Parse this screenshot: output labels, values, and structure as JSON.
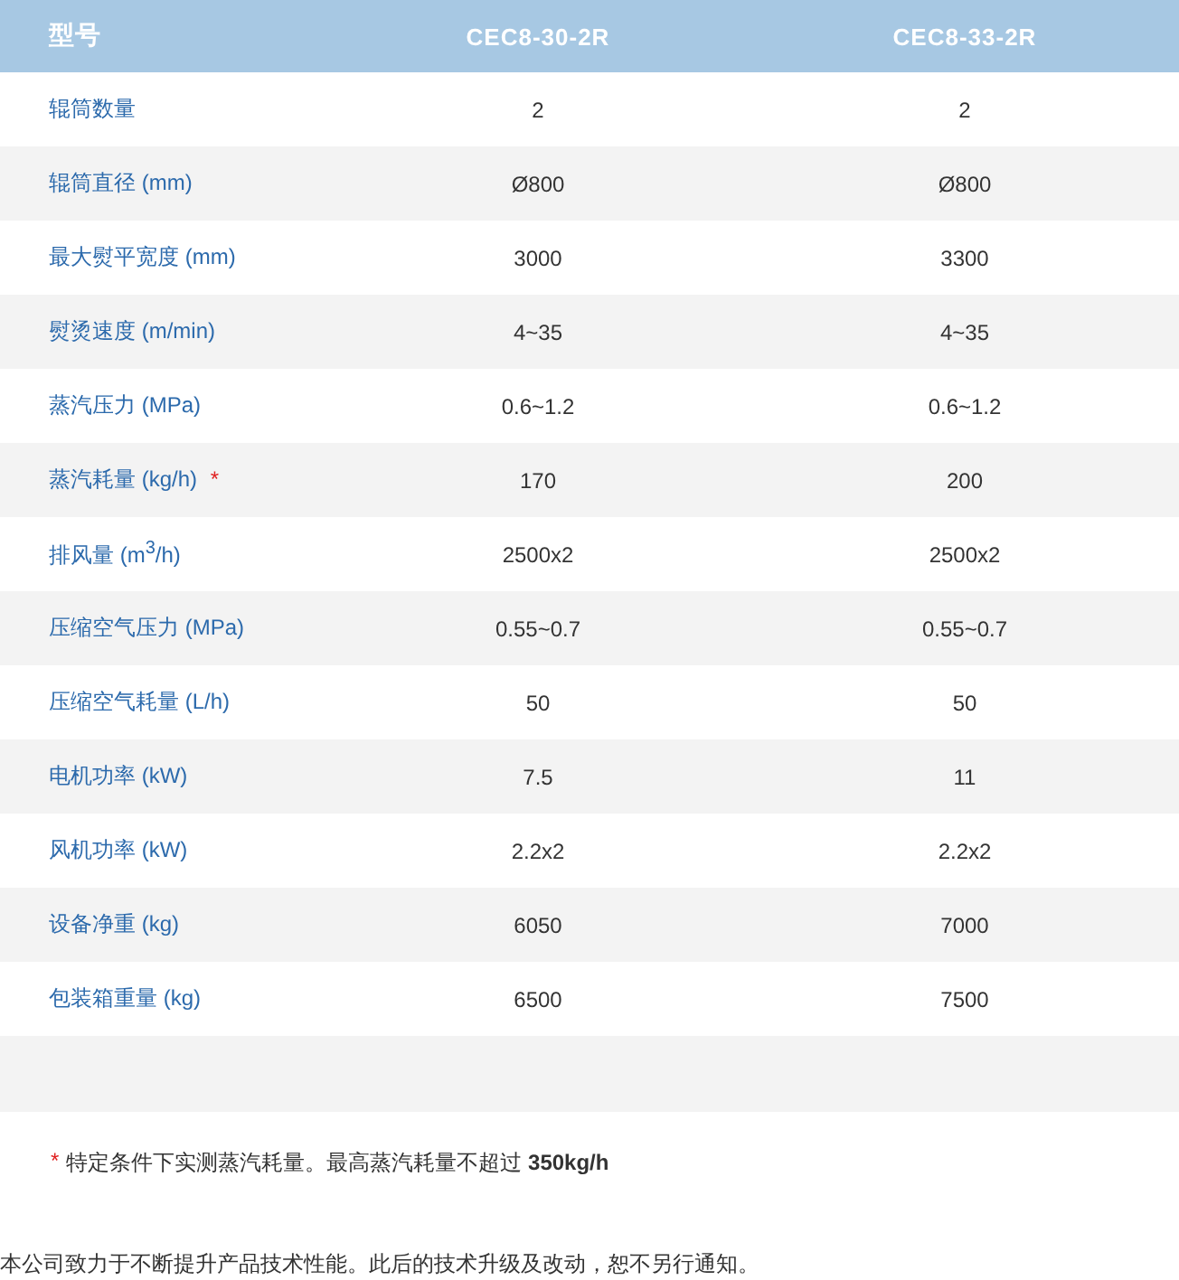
{
  "table": {
    "columns": [
      "型号",
      "CEC8-30-2R",
      "CEC8-33-2R"
    ],
    "rows": [
      {
        "label": "辊筒数量",
        "values": [
          "2",
          "2"
        ]
      },
      {
        "label": "辊筒直径 (mm)",
        "values": [
          "Ø800",
          "Ø800"
        ]
      },
      {
        "label": "最大熨平宽度 (mm)",
        "values": [
          "3000",
          "3300"
        ]
      },
      {
        "label": "熨烫速度 (m/min)",
        "values": [
          "4~35",
          "4~35"
        ]
      },
      {
        "label": "蒸汽压力 (MPa)",
        "values": [
          "0.6~1.2",
          "0.6~1.2"
        ]
      },
      {
        "label": "蒸汽耗量 (kg/h)",
        "note_mark": "*",
        "values": [
          "170",
          "200"
        ]
      },
      {
        "label": "排风量 (m$^{3}$/h)",
        "values": [
          "2500x2",
          "2500x2"
        ]
      },
      {
        "label": "压缩空气压力 (MPa)",
        "values": [
          "0.55~0.7",
          "0.55~0.7"
        ]
      },
      {
        "label": "压缩空气耗量 (L/h)",
        "values": [
          "50",
          "50"
        ]
      },
      {
        "label": "电机功率 (kW)",
        "values": [
          "7.5",
          "11"
        ]
      },
      {
        "label": "风机功率 (kW)",
        "values": [
          "2.2x2",
          "2.2x2"
        ]
      },
      {
        "label": "设备净重 (kg)",
        "values": [
          "6050",
          "7000"
        ]
      },
      {
        "label": "包装箱重量 (kg)",
        "values": [
          "6500",
          "7500"
        ]
      }
    ]
  },
  "footnote": {
    "mark": "*",
    "text": "特定条件下实测蒸汽耗量。最高蒸汽耗量不超过 **350kg/h**"
  },
  "disclaimer": "本公司致力于不断提升产品技术性能。此后的技术升级及改动，恕不另行通知。"
}
